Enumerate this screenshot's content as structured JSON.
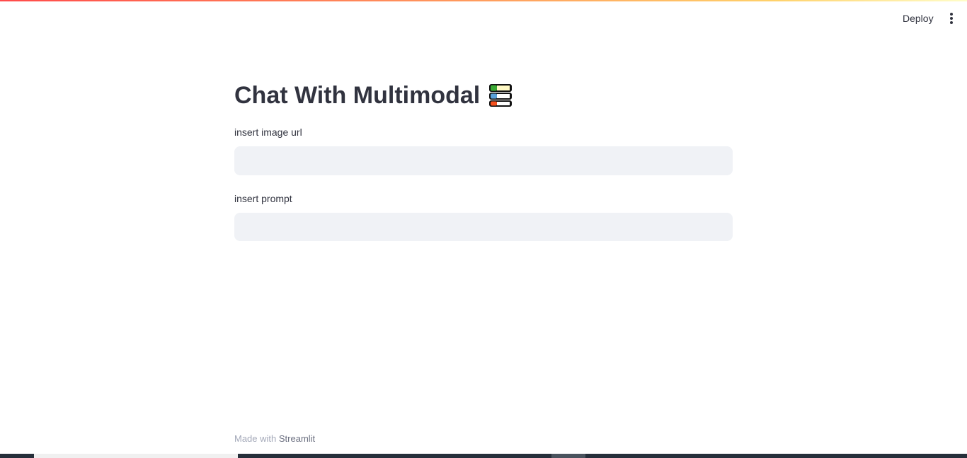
{
  "header": {
    "deploy_label": "Deploy",
    "menu_icon": "vertical-ellipsis-icon"
  },
  "main": {
    "title": "Chat With Multimodal",
    "title_icon": "books-icon",
    "fields": [
      {
        "label": "insert image url",
        "value": "",
        "placeholder": ""
      },
      {
        "label": "insert prompt",
        "value": "",
        "placeholder": ""
      }
    ]
  },
  "footer": {
    "prefix": "Made with ",
    "brand": "Streamlit"
  },
  "colors": {
    "accent_gradient_start": "#ff4b4b",
    "accent_gradient_end": "#fffdc8",
    "input_bg": "#f0f2f6",
    "text": "#31333f",
    "footer_text": "#a3a8b8"
  }
}
